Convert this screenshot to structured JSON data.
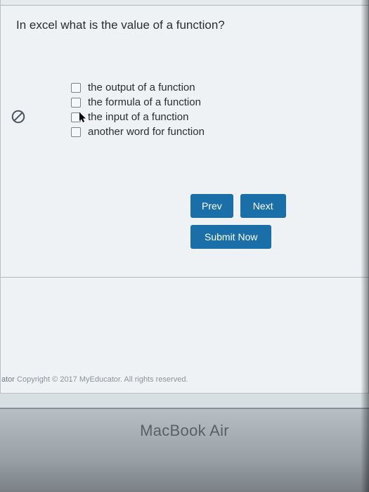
{
  "question": {
    "title": "In excel what is the value of a function?",
    "options": [
      "the output of a function",
      "the formula of a function",
      "the input of a function",
      "another word for function"
    ]
  },
  "buttons": {
    "prev": "Prev",
    "next": "Next",
    "submit": "Submit Now"
  },
  "footer": {
    "prefix": "ator",
    "text": " Copyright © 2017 MyEducator. All rights reserved."
  },
  "hardware": {
    "label": "MacBook Air"
  }
}
